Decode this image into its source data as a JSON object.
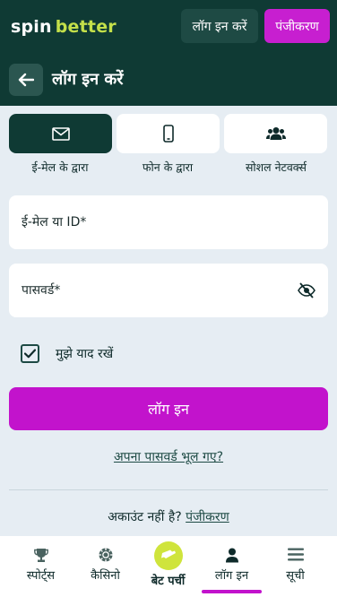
{
  "header": {
    "logo_spin": "spin",
    "logo_better": "better",
    "login_label": "लॉग इन करें",
    "register_label": "पंजीकरण"
  },
  "titlebar": {
    "title": "लॉग इन करें"
  },
  "tabs": [
    {
      "label": "ई-मेल के द्वारा",
      "icon": "envelope-icon",
      "active": true
    },
    {
      "label": "फोन के द्वारा",
      "icon": "phone-icon",
      "active": false
    },
    {
      "label": "सोशल नेटवर्क्स",
      "icon": "users-icon",
      "active": false
    }
  ],
  "form": {
    "email_label": "ई-मेल या ID*",
    "password_label": "पासवर्ड*",
    "remember_label": "मुझे याद रखें",
    "remember_checked": true,
    "login_button": "लॉग इन",
    "forgot_link": "अपना पासवर्ड भूल गए?",
    "no_account_text": "अकाउंट नहीं है?",
    "register_link": "पंजीकरण"
  },
  "bottom_nav": [
    {
      "label": "स्पोर्ट्स",
      "icon": "trophy-icon"
    },
    {
      "label": "कैसिनो",
      "icon": "chip-icon"
    },
    {
      "label": "बेट पर्ची",
      "icon": "ticket-icon"
    },
    {
      "label": "लॉग इन",
      "icon": "user-icon",
      "active": true
    },
    {
      "label": "सूची",
      "icon": "menu-icon"
    }
  ],
  "colors": {
    "header_bg": "#0f3a34",
    "accent_magenta": "#c213cc",
    "logo_green": "#c4e04a",
    "background": "#e6edf3"
  }
}
